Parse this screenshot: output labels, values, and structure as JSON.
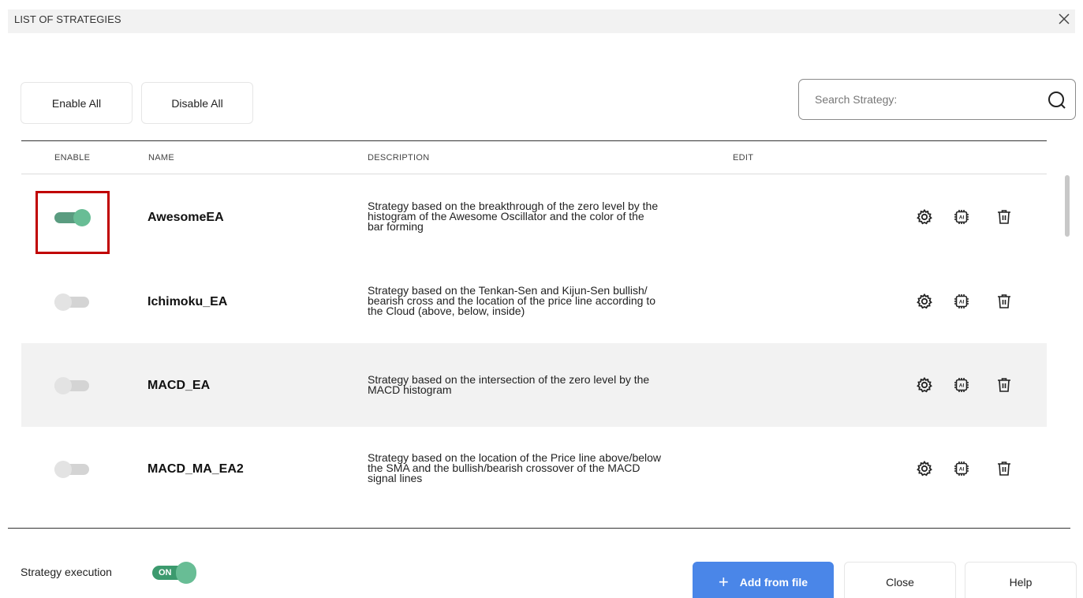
{
  "window": {
    "title": "LIST OF STRATEGIES",
    "close_icon": "close-icon"
  },
  "toolbar": {
    "enable_all": "Enable All",
    "disable_all": "Disable All"
  },
  "search": {
    "placeholder": "Search Strategy:",
    "value": "",
    "icon": "search-icon"
  },
  "table": {
    "headers": {
      "enable": "ENABLE",
      "name": "NAME",
      "description": "DESCRIPTION",
      "edit": "EDIT"
    },
    "rows": [
      {
        "enabled": true,
        "name": "AwesomeEA",
        "description_lines": [
          "Strategy based on the breakthrough of the zero level by the",
          "histogram of the Awesome Oscillator and the color of the",
          "bar forming"
        ]
      },
      {
        "enabled": false,
        "name": "Ichimoku_EA",
        "description_lines": [
          "Strategy based on the Tenkan-Sen and Kijun-Sen bullish/",
          "bearish cross and the location of the price line according to",
          "the Cloud (above, below, inside)"
        ]
      },
      {
        "enabled": false,
        "name": "MACD_EA",
        "description_lines": [
          "Strategy based on the intersection of the zero level by the",
          "MACD histogram"
        ]
      },
      {
        "enabled": false,
        "name": "MACD_MA_EA2",
        "description_lines": [
          "Strategy based on the location of the Price line above/below",
          "the SMA and the bullish/bearish crossover of the MACD",
          "signal lines"
        ]
      }
    ],
    "row_icons": [
      "gear-icon",
      "ai-chip-icon",
      "trash-icon"
    ]
  },
  "footer": {
    "execution_label": "Strategy execution",
    "execution_state": "ON",
    "add_from_file": "Add from file",
    "close": "Close",
    "help": "Help"
  },
  "colors": {
    "toggle_on": "#68bd95",
    "toggle_off": "#e3e3e3",
    "primary_button": "#4a86e8",
    "highlight": "#c00000",
    "alt_row": "#f2f2f2"
  }
}
